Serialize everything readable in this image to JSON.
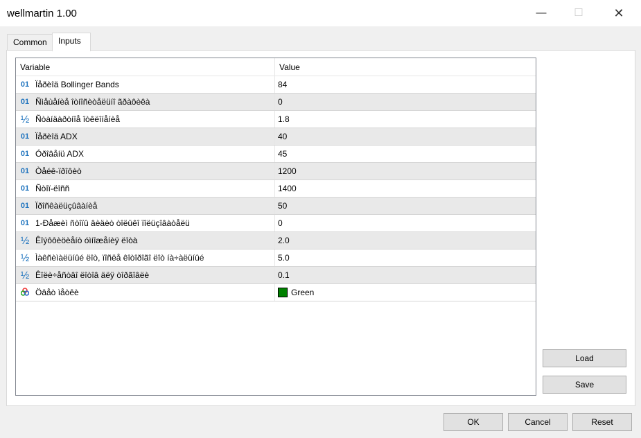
{
  "window": {
    "title": "wellmartin 1.00"
  },
  "tabs": [
    {
      "label": "Common"
    },
    {
      "label": "Inputs",
      "active": true
    }
  ],
  "table": {
    "headers": [
      "Variable",
      "Value"
    ],
    "rows": [
      {
        "type": "int",
        "icon": "integer-icon",
        "name": "Ïåðèîä Bollinger Bands",
        "value": "84"
      },
      {
        "type": "int",
        "icon": "integer-icon",
        "name": "Ñìåùåíèå îòíîñèòåëüíî ãðàôèêà",
        "value": "0"
      },
      {
        "type": "double",
        "icon": "fraction-icon",
        "name": "Ñòàíäàðòíîå îòêëîíåíèå",
        "value": "1.8"
      },
      {
        "type": "int",
        "icon": "integer-icon",
        "name": "Ïåðèîä ADX",
        "value": "40"
      },
      {
        "type": "int",
        "icon": "integer-icon",
        "name": "Óðîâåíü ADX",
        "value": "45"
      },
      {
        "type": "int",
        "icon": "integer-icon",
        "name": "Òåéê-ïðîôèò",
        "value": "1200"
      },
      {
        "type": "int",
        "icon": "integer-icon",
        "name": "Ñòîï-ëîññ",
        "value": "1400"
      },
      {
        "type": "int",
        "icon": "integer-icon",
        "name": "Ïðîñêàëüçûâàíèå",
        "value": "50"
      },
      {
        "type": "int",
        "icon": "integer-icon",
        "name": "1-Ðåæèì ñòîïû âèäèò òîëüêî ïîëüçîâàòåëü",
        "value": "0"
      },
      {
        "type": "double",
        "icon": "fraction-icon",
        "name": "Êîýôôèöèåíò óìíîæåíèÿ ëîòà",
        "value": "2.0"
      },
      {
        "type": "double",
        "icon": "fraction-icon",
        "name": "Ìàêñèìàëüíûé ëîò, ïîñëå êîòîðîãî ëîò íà÷àëüíûé",
        "value": "5.0"
      },
      {
        "type": "double",
        "icon": "fraction-icon",
        "name": "Êîëè÷åñòâî ëîòîâ äëÿ òîðãîâëè",
        "value": "0.1"
      },
      {
        "type": "color",
        "icon": "color-icon",
        "name": "Öâåò ìåòêè",
        "value": "Green",
        "swatch": "#008000"
      }
    ]
  },
  "buttons": {
    "load": "Load",
    "save": "Save",
    "ok": "OK",
    "cancel": "Cancel",
    "reset": "Reset"
  }
}
